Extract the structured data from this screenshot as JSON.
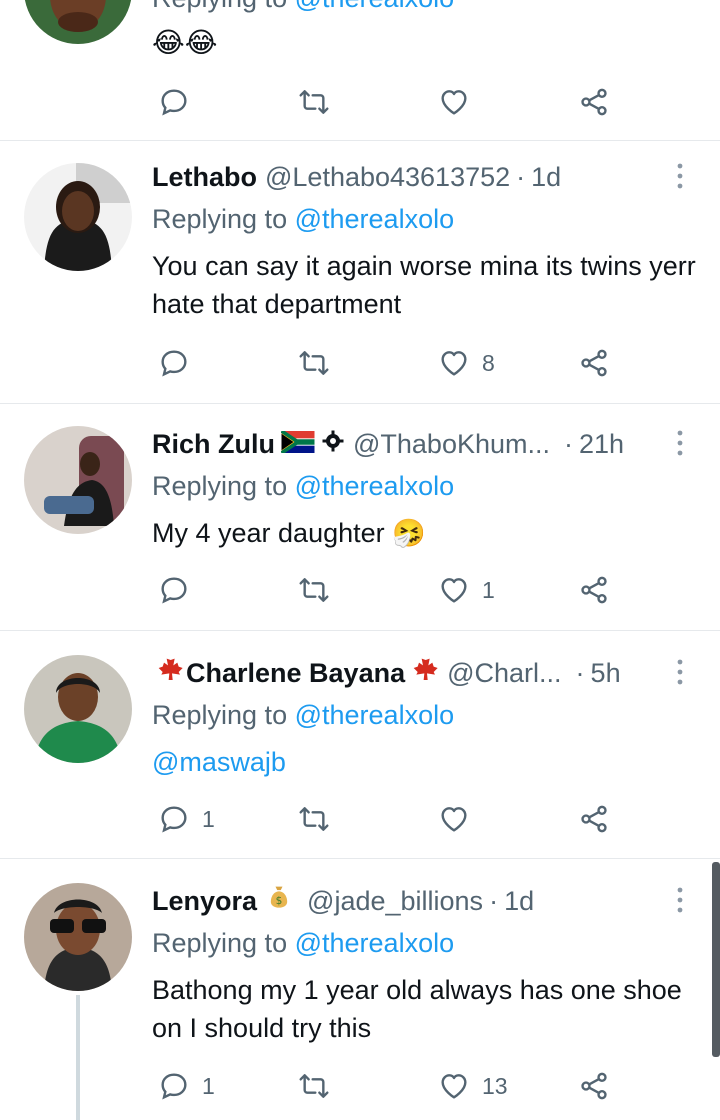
{
  "tweets": [
    {
      "partial_top": true,
      "reply_label": "Replying to",
      "reply_mention": "@therealxolo",
      "text": "😂😂"
    },
    {
      "name": "Lethabo",
      "handle": "@Lethabo43613752",
      "dot": "·",
      "time": "1d",
      "reply_label": "Replying to",
      "reply_mention": "@therealxolo",
      "text": "You can say it again worse mina its twins yerr hate that department",
      "likes": "8"
    },
    {
      "name": "Rich Zulu",
      "name_badges": [
        "south-africa-flag",
        "gear-icon"
      ],
      "handle": "@ThaboKhum...",
      "dot": "·",
      "time": "21h",
      "reply_label": "Replying to",
      "reply_mention": "@therealxolo",
      "text": "My 4 year daughter 🤧",
      "likes": "1"
    },
    {
      "name": "Charlene Bayana",
      "name_badges": [
        "maple-leaf",
        "maple-leaf"
      ],
      "handle": "@Charl...",
      "dot": "·",
      "time": "5h",
      "reply_label": "Replying to",
      "reply_mention": "@therealxolo",
      "text": "@maswajb",
      "replies": "1"
    },
    {
      "name": "Lenyora",
      "name_badges": [
        "money-bag"
      ],
      "handle": "@jade_billions",
      "dot": "·",
      "time": "1d",
      "reply_label": "Replying to",
      "reply_mention": "@therealxolo",
      "text": "Bathong my 1 year old always has one shoe on I should try this",
      "replies": "1",
      "likes": "13"
    }
  ],
  "colors": {
    "text": "#0f1419",
    "muted": "#536471",
    "link": "#1d9bf0",
    "divider": "#e6e9ec"
  }
}
